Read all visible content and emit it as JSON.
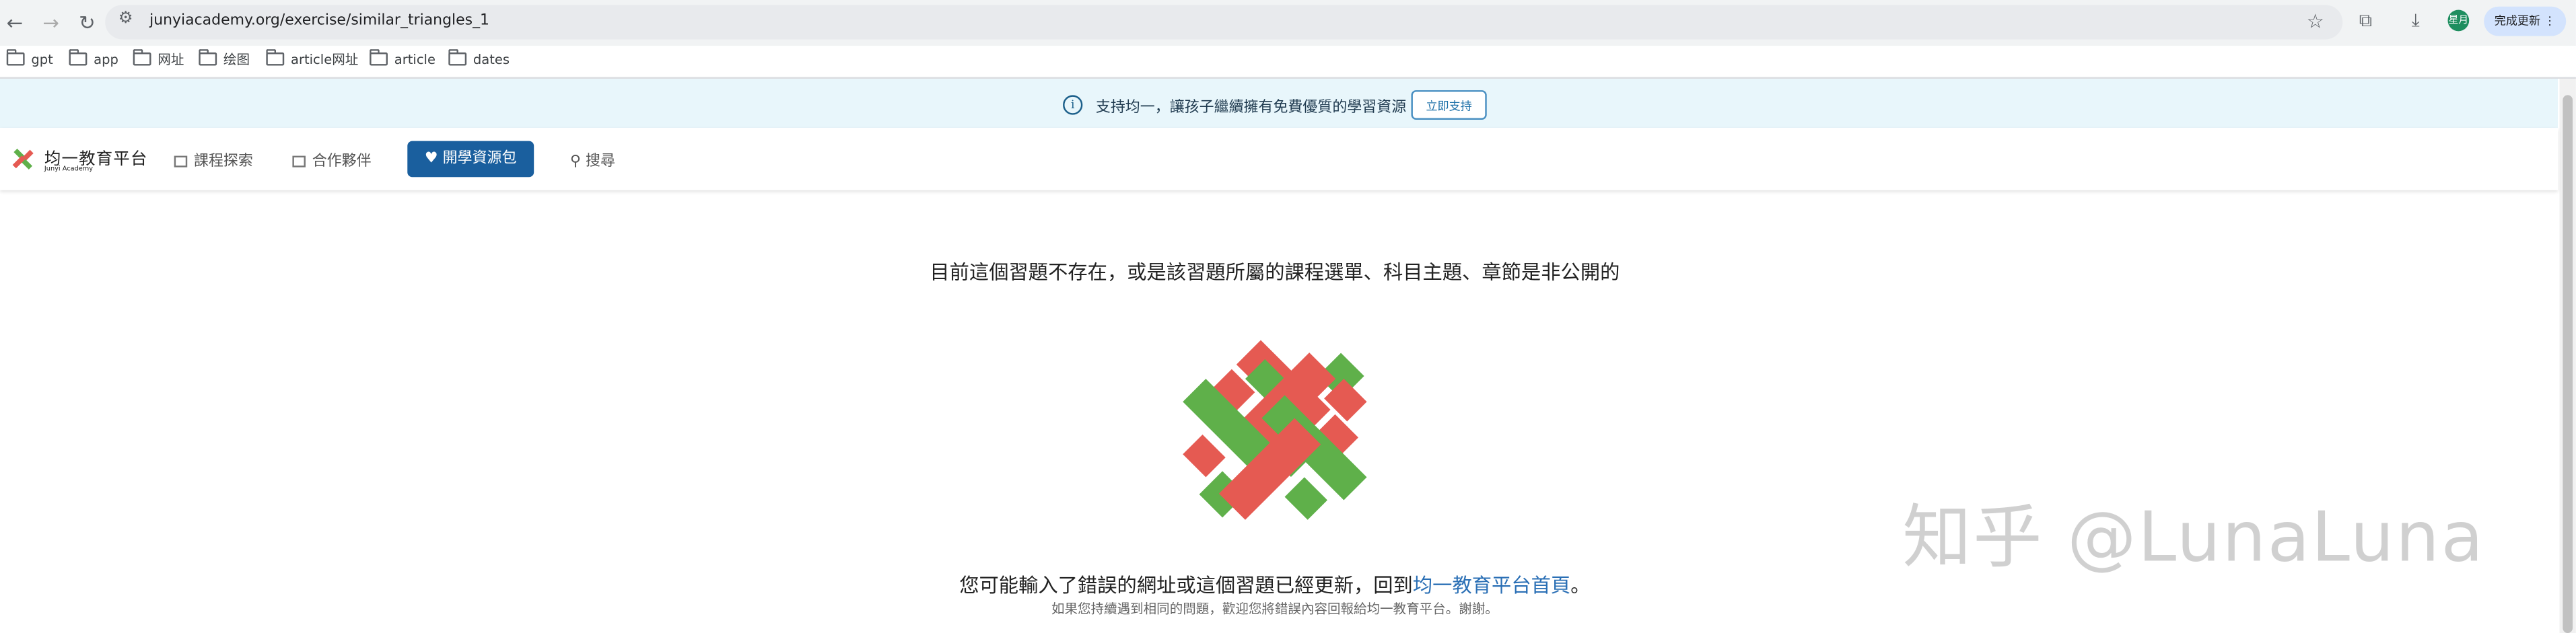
{
  "browser": {
    "url": "junyiacademy.org/exercise/similar_triangles_1",
    "update_label": "完成更新",
    "avatar_text": "星月",
    "bookmarks": [
      "gpt",
      "app",
      "网址",
      "绘图",
      "article网址",
      "article",
      "dates"
    ]
  },
  "banner": {
    "text": "支持均一，讓孩子繼續擁有免費優質的學習資源",
    "button": "立即支持"
  },
  "header": {
    "logo_text": "均一教育平台",
    "logo_sub": "Junyi Academy",
    "nav": [
      "課程探索",
      "合作夥伴"
    ],
    "donate": "開學資源包",
    "search": "搜尋"
  },
  "main": {
    "title": "目前這個習題不存在，或是該習題所屬的課程選單、科目主題、章節是非公開的",
    "message_prefix": "您可能輸入了錯誤的網址或這個習題已經更新，回到",
    "home_link": "均一教育平台首頁",
    "message_suffix": "。",
    "hint": "如果您持續遇到相同的問題，歡迎您將錯誤內容回報給均一教育平台。謝謝。"
  },
  "watermark": "知乎 @LunaLuna",
  "colors": {
    "green": "#5fb04a",
    "red": "#e55a52",
    "brand_blue": "#1a5f9e",
    "banner_bg": "#e8f6fb"
  }
}
